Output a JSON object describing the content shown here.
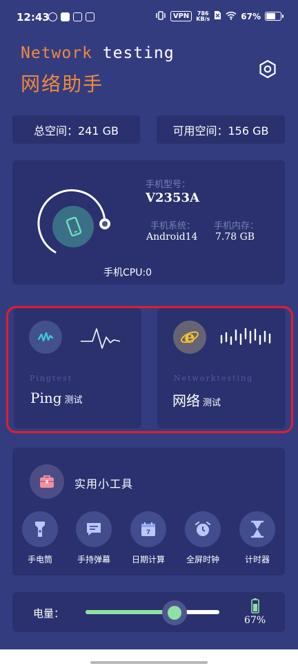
{
  "status_bar": {
    "time": "12:43",
    "vpn": "VPN",
    "speed_value": "786",
    "speed_unit": "KB/s",
    "battery_percent": "67%",
    "battery_level": 0.67
  },
  "header": {
    "title_en_part1": "Network",
    "title_en_part2": "testing",
    "title_cn": "网络助手",
    "settings_icon": "hexagon-gear-icon"
  },
  "storage": {
    "total": "总空间：241 GB",
    "free": "可用空间：156 GB"
  },
  "device": {
    "model_label": "手机型号：",
    "model_value": "V2353A",
    "os_label": "手机系统：",
    "os_value": "Android14",
    "memory_label": "手机内存：",
    "memory_value": "7.78 GB",
    "cpu": "手机CPU:0"
  },
  "tests": {
    "ping": {
      "subtitle": "Pingtest",
      "title": "Ping",
      "title_suffix": "测试"
    },
    "network": {
      "subtitle": "Networktesting",
      "title": "网络",
      "title_suffix": "测试"
    }
  },
  "tools": {
    "title": "实用小工具",
    "items": [
      {
        "label": "手电筒",
        "icon": "flashlight-icon"
      },
      {
        "label": "手持弹幕",
        "icon": "message-icon"
      },
      {
        "label": "日期计算",
        "icon": "calendar-icon"
      },
      {
        "label": "全屏时钟",
        "icon": "alarm-clock-icon"
      },
      {
        "label": "计时器",
        "icon": "hourglass-icon"
      }
    ]
  },
  "battery": {
    "label": "电量：",
    "percent": "67%",
    "level": 0.67
  },
  "colors": {
    "background": "#343c80",
    "card": "#2a316e",
    "accent_orange": "#f08a3a",
    "accent_green": "#8fe0a4",
    "highlight_red": "#e01e2e"
  }
}
